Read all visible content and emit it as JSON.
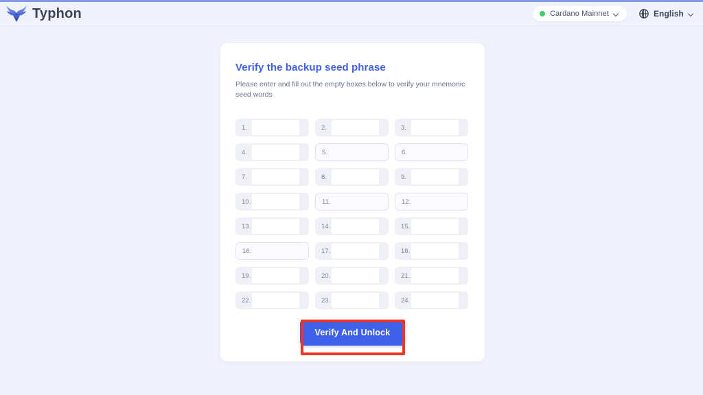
{
  "theme": {
    "page_background": "#f0f3fc",
    "accent_blue": "#3f60e8",
    "card_background": "#ffffff",
    "top_bar_color": "#8698ef",
    "status_dot_color": "#3ecf70",
    "highlight_box_color": "#f03528",
    "muted_text": "#6b7490"
  },
  "header": {
    "logo_icon": "typhon-bull-logo-icon",
    "brand_name": "Typhon",
    "network": {
      "icon": "status-dot-icon",
      "label": "Cardano Mainnet",
      "chevron_icon": "chevron-down-icon"
    },
    "language": {
      "icon": "globe-icon",
      "label": "English",
      "chevron_icon": "chevron-down-icon"
    }
  },
  "card": {
    "title": "Verify the backup seed phrase",
    "subtitle": "Please enter and fill out the empty boxes below to verify your mnemonic seed words",
    "submit_label": "Verify And Unlock"
  },
  "seed_words": [
    {
      "index": "1.",
      "value": "",
      "state": "filled"
    },
    {
      "index": "2.",
      "value": "",
      "state": "filled"
    },
    {
      "index": "3.",
      "value": "",
      "state": "filled"
    },
    {
      "index": "4.",
      "value": "",
      "state": "filled"
    },
    {
      "index": "5.",
      "value": "",
      "state": "empty"
    },
    {
      "index": "6.",
      "value": "",
      "state": "empty"
    },
    {
      "index": "7.",
      "value": "",
      "state": "filled"
    },
    {
      "index": "8.",
      "value": "",
      "state": "filled"
    },
    {
      "index": "9.",
      "value": "",
      "state": "filled"
    },
    {
      "index": "10.",
      "value": "",
      "state": "filled"
    },
    {
      "index": "11.",
      "value": "",
      "state": "empty"
    },
    {
      "index": "12.",
      "value": "",
      "state": "empty"
    },
    {
      "index": "13.",
      "value": "",
      "state": "filled"
    },
    {
      "index": "14.",
      "value": "",
      "state": "filled"
    },
    {
      "index": "15.",
      "value": "",
      "state": "filled"
    },
    {
      "index": "16.",
      "value": "",
      "state": "empty"
    },
    {
      "index": "17.",
      "value": "",
      "state": "filled"
    },
    {
      "index": "18.",
      "value": "",
      "state": "filled"
    },
    {
      "index": "19.",
      "value": "",
      "state": "filled"
    },
    {
      "index": "20.",
      "value": "",
      "state": "filled"
    },
    {
      "index": "21.",
      "value": "",
      "state": "filled"
    },
    {
      "index": "22.",
      "value": "",
      "state": "filled"
    },
    {
      "index": "23.",
      "value": "",
      "state": "filled"
    },
    {
      "index": "24.",
      "value": "",
      "state": "filled"
    }
  ]
}
